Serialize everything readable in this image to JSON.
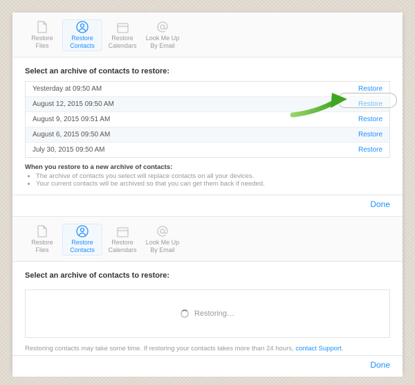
{
  "toolbar": {
    "files": {
      "line1": "Restore",
      "line2": "Files"
    },
    "contacts": {
      "line1": "Restore",
      "line2": "Contacts"
    },
    "calendars": {
      "line1": "Restore",
      "line2": "Calendars"
    },
    "lookmeup": {
      "line1": "Look Me Up",
      "line2": "By Email"
    }
  },
  "heading": "Select an archive of contacts to restore:",
  "archives": [
    {
      "date": "Yesterday at 09:50 AM",
      "action": "Restore"
    },
    {
      "date": "August 12, 2015 09:50 AM",
      "action": "Restore"
    },
    {
      "date": "August 9, 2015 09:51 AM",
      "action": "Restore"
    },
    {
      "date": "August 6, 2015 09:50 AM",
      "action": "Restore"
    },
    {
      "date": "July 30, 2015 09:50 AM",
      "action": "Restore"
    }
  ],
  "notes_title": "When you restore to a new archive of contacts:",
  "notes": [
    "The archive of contacts you select will replace contacts on all your devices.",
    "Your current contacts will be archived so that you can get them back if needed."
  ],
  "done_label": "Done",
  "restoring_label": "Restoring…",
  "footer_note_text": "Restoring contacts may take some time. If restoring your contacts takes more than 24 hours, ",
  "footer_note_link": "contact Support",
  "footer_note_after": "."
}
